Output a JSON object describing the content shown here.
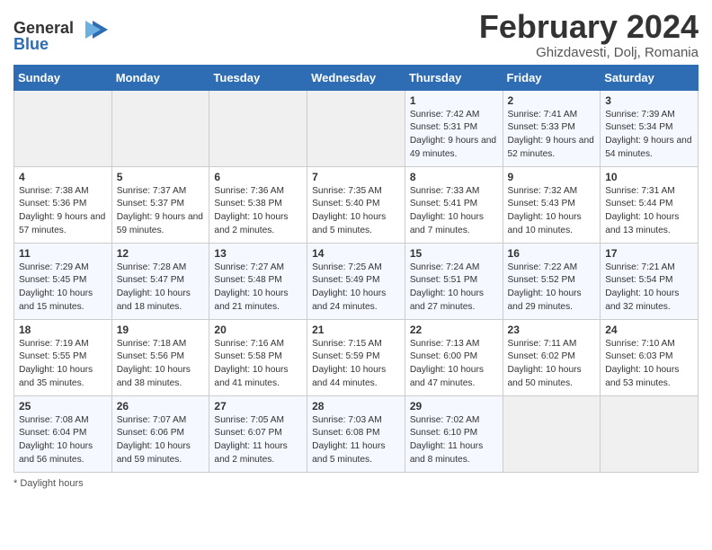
{
  "header": {
    "logo_line1": "General",
    "logo_line2": "Blue",
    "month_title": "February 2024",
    "location": "Ghizdavesti, Dolj, Romania"
  },
  "weekdays": [
    "Sunday",
    "Monday",
    "Tuesday",
    "Wednesday",
    "Thursday",
    "Friday",
    "Saturday"
  ],
  "weeks": [
    [
      {
        "day": "",
        "info": ""
      },
      {
        "day": "",
        "info": ""
      },
      {
        "day": "",
        "info": ""
      },
      {
        "day": "",
        "info": ""
      },
      {
        "day": "1",
        "info": "Sunrise: 7:42 AM\nSunset: 5:31 PM\nDaylight: 9 hours and 49 minutes."
      },
      {
        "day": "2",
        "info": "Sunrise: 7:41 AM\nSunset: 5:33 PM\nDaylight: 9 hours and 52 minutes."
      },
      {
        "day": "3",
        "info": "Sunrise: 7:39 AM\nSunset: 5:34 PM\nDaylight: 9 hours and 54 minutes."
      }
    ],
    [
      {
        "day": "4",
        "info": "Sunrise: 7:38 AM\nSunset: 5:36 PM\nDaylight: 9 hours and 57 minutes."
      },
      {
        "day": "5",
        "info": "Sunrise: 7:37 AM\nSunset: 5:37 PM\nDaylight: 9 hours and 59 minutes."
      },
      {
        "day": "6",
        "info": "Sunrise: 7:36 AM\nSunset: 5:38 PM\nDaylight: 10 hours and 2 minutes."
      },
      {
        "day": "7",
        "info": "Sunrise: 7:35 AM\nSunset: 5:40 PM\nDaylight: 10 hours and 5 minutes."
      },
      {
        "day": "8",
        "info": "Sunrise: 7:33 AM\nSunset: 5:41 PM\nDaylight: 10 hours and 7 minutes."
      },
      {
        "day": "9",
        "info": "Sunrise: 7:32 AM\nSunset: 5:43 PM\nDaylight: 10 hours and 10 minutes."
      },
      {
        "day": "10",
        "info": "Sunrise: 7:31 AM\nSunset: 5:44 PM\nDaylight: 10 hours and 13 minutes."
      }
    ],
    [
      {
        "day": "11",
        "info": "Sunrise: 7:29 AM\nSunset: 5:45 PM\nDaylight: 10 hours and 15 minutes."
      },
      {
        "day": "12",
        "info": "Sunrise: 7:28 AM\nSunset: 5:47 PM\nDaylight: 10 hours and 18 minutes."
      },
      {
        "day": "13",
        "info": "Sunrise: 7:27 AM\nSunset: 5:48 PM\nDaylight: 10 hours and 21 minutes."
      },
      {
        "day": "14",
        "info": "Sunrise: 7:25 AM\nSunset: 5:49 PM\nDaylight: 10 hours and 24 minutes."
      },
      {
        "day": "15",
        "info": "Sunrise: 7:24 AM\nSunset: 5:51 PM\nDaylight: 10 hours and 27 minutes."
      },
      {
        "day": "16",
        "info": "Sunrise: 7:22 AM\nSunset: 5:52 PM\nDaylight: 10 hours and 29 minutes."
      },
      {
        "day": "17",
        "info": "Sunrise: 7:21 AM\nSunset: 5:54 PM\nDaylight: 10 hours and 32 minutes."
      }
    ],
    [
      {
        "day": "18",
        "info": "Sunrise: 7:19 AM\nSunset: 5:55 PM\nDaylight: 10 hours and 35 minutes."
      },
      {
        "day": "19",
        "info": "Sunrise: 7:18 AM\nSunset: 5:56 PM\nDaylight: 10 hours and 38 minutes."
      },
      {
        "day": "20",
        "info": "Sunrise: 7:16 AM\nSunset: 5:58 PM\nDaylight: 10 hours and 41 minutes."
      },
      {
        "day": "21",
        "info": "Sunrise: 7:15 AM\nSunset: 5:59 PM\nDaylight: 10 hours and 44 minutes."
      },
      {
        "day": "22",
        "info": "Sunrise: 7:13 AM\nSunset: 6:00 PM\nDaylight: 10 hours and 47 minutes."
      },
      {
        "day": "23",
        "info": "Sunrise: 7:11 AM\nSunset: 6:02 PM\nDaylight: 10 hours and 50 minutes."
      },
      {
        "day": "24",
        "info": "Sunrise: 7:10 AM\nSunset: 6:03 PM\nDaylight: 10 hours and 53 minutes."
      }
    ],
    [
      {
        "day": "25",
        "info": "Sunrise: 7:08 AM\nSunset: 6:04 PM\nDaylight: 10 hours and 56 minutes."
      },
      {
        "day": "26",
        "info": "Sunrise: 7:07 AM\nSunset: 6:06 PM\nDaylight: 10 hours and 59 minutes."
      },
      {
        "day": "27",
        "info": "Sunrise: 7:05 AM\nSunset: 6:07 PM\nDaylight: 11 hours and 2 minutes."
      },
      {
        "day": "28",
        "info": "Sunrise: 7:03 AM\nSunset: 6:08 PM\nDaylight: 11 hours and 5 minutes."
      },
      {
        "day": "29",
        "info": "Sunrise: 7:02 AM\nSunset: 6:10 PM\nDaylight: 11 hours and 8 minutes."
      },
      {
        "day": "",
        "info": ""
      },
      {
        "day": "",
        "info": ""
      }
    ]
  ],
  "footer": {
    "daylight_label": "Daylight hours"
  }
}
